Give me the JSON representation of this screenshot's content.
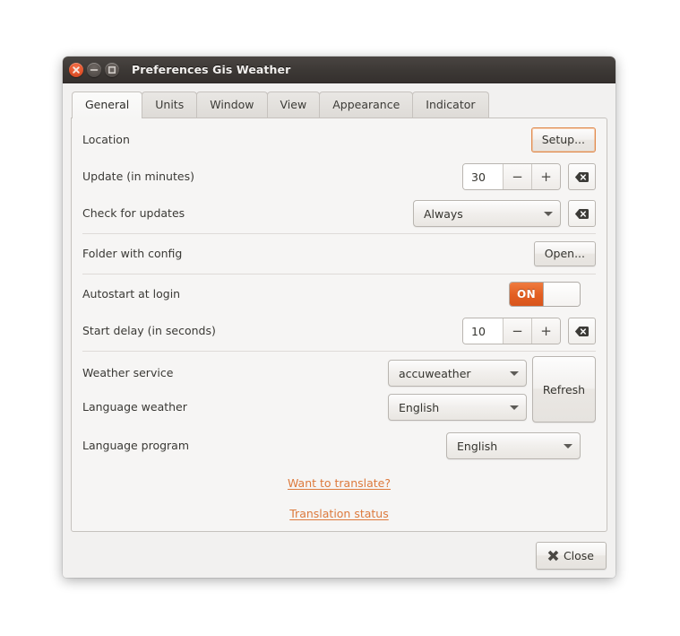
{
  "window": {
    "title": "Preferences Gis Weather",
    "controls": {
      "close": "close-window",
      "minimize": "minimize-window",
      "maximize": "maximize-window"
    }
  },
  "tabs": [
    {
      "label": "General",
      "active": true
    },
    {
      "label": "Units",
      "active": false
    },
    {
      "label": "Window",
      "active": false
    },
    {
      "label": "View",
      "active": false
    },
    {
      "label": "Appearance",
      "active": false
    },
    {
      "label": "Indicator",
      "active": false
    }
  ],
  "general": {
    "location": {
      "label": "Location",
      "setup_button": "Setup..."
    },
    "update_interval": {
      "label": "Update (in minutes)",
      "value": "30",
      "minus": "−",
      "plus": "+",
      "reset_icon": "clear-icon"
    },
    "check_updates": {
      "label": "Check for updates",
      "value": "Always",
      "options": [
        "Always"
      ],
      "reset_icon": "clear-icon"
    },
    "folder_config": {
      "label": "Folder with config",
      "open_button": "Open..."
    },
    "autostart": {
      "label": "Autostart at login",
      "state": "ON"
    },
    "start_delay": {
      "label": "Start delay (in seconds)",
      "value": "10",
      "minus": "−",
      "plus": "+",
      "reset_icon": "clear-icon"
    },
    "weather_service": {
      "label": "Weather service",
      "value": "accuweather",
      "options": [
        "accuweather"
      ]
    },
    "language_weather": {
      "label": "Language weather",
      "value": "English",
      "options": [
        "English"
      ]
    },
    "refresh_button": "Refresh",
    "language_program": {
      "label": "Language program",
      "value": "English",
      "options": [
        "English"
      ]
    },
    "links": [
      {
        "label": "Want to translate?"
      },
      {
        "label": "Translation status"
      }
    ]
  },
  "footer": {
    "close_button": "Close"
  },
  "colors": {
    "accent_orange": "#e35f22",
    "link_orange": "#dd7a3d",
    "titlebar": "#3c3835",
    "panel_bg": "#f6f5f4"
  }
}
